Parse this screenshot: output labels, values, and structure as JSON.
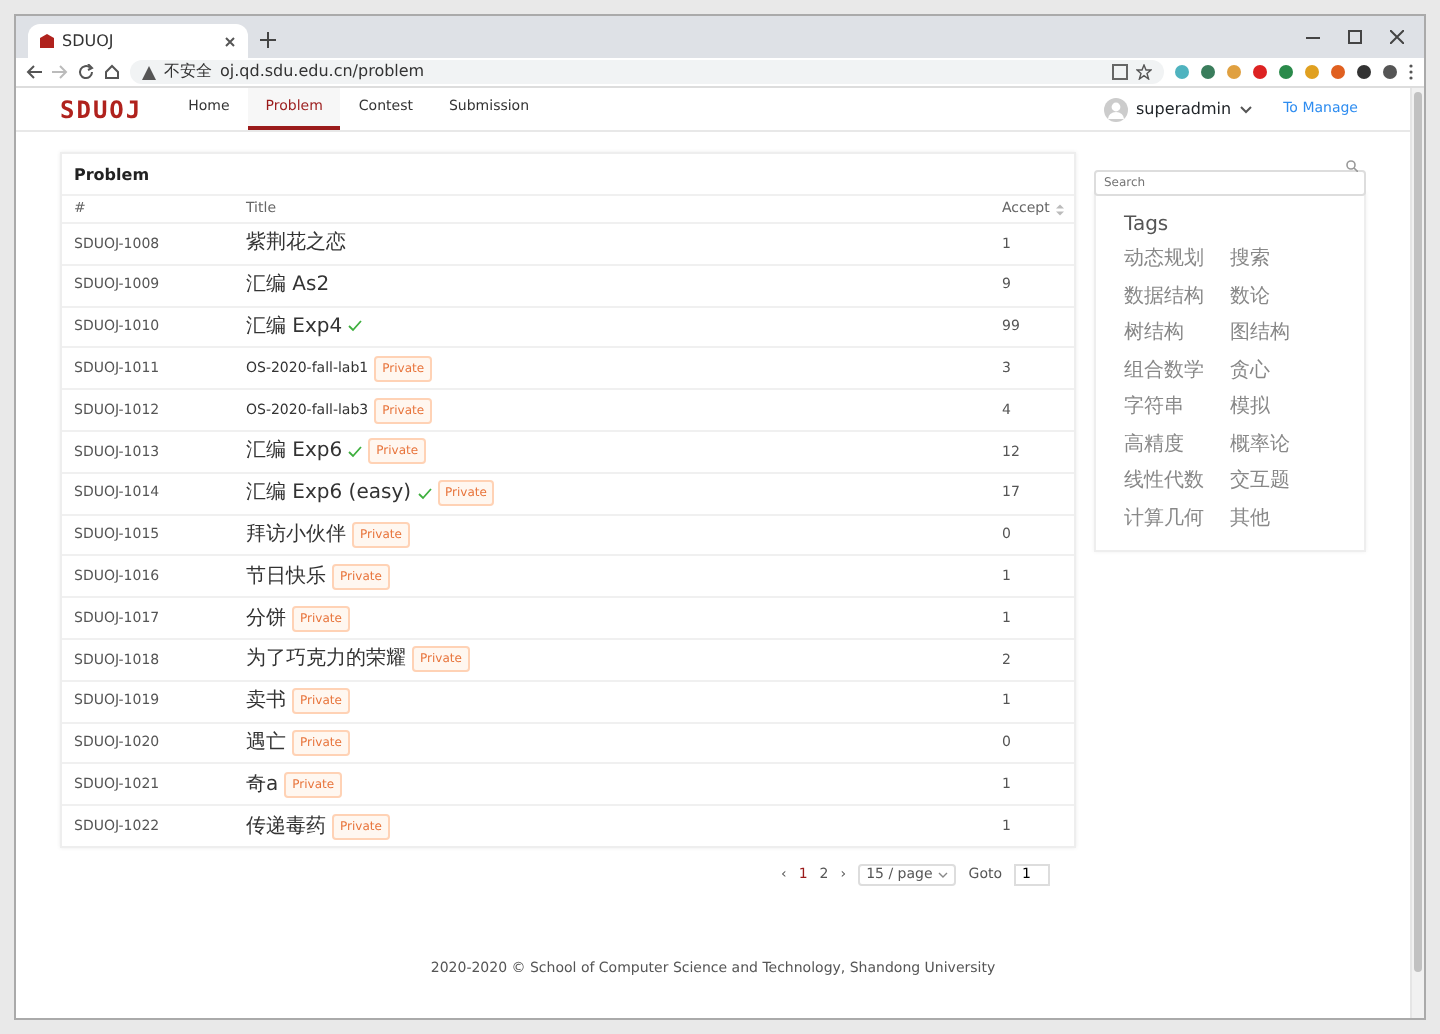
{
  "browser": {
    "tab_title": "SDUOJ",
    "security_label": "不安全",
    "url": "oj.qd.sdu.edu.cn/problem"
  },
  "navbar": {
    "logo": "SDUOJ",
    "items": [
      {
        "label": "Home",
        "selected": false
      },
      {
        "label": "Problem",
        "selected": true
      },
      {
        "label": "Contest",
        "selected": false
      },
      {
        "label": "Submission",
        "selected": false
      }
    ],
    "user": "superadmin",
    "manage_link": "To Manage"
  },
  "problem_card": {
    "title": "Problem",
    "columns": [
      "#",
      "Title",
      "Accept"
    ],
    "rows": [
      {
        "id": "SDUOJ-1008",
        "title": "紫荆花之恋",
        "solved": false,
        "private": false,
        "accept": "1"
      },
      {
        "id": "SDUOJ-1009",
        "title": "汇编 As2",
        "solved": false,
        "private": false,
        "accept": "9"
      },
      {
        "id": "SDUOJ-1010",
        "title": "汇编 Exp4",
        "solved": true,
        "private": false,
        "accept": "99"
      },
      {
        "id": "SDUOJ-1011",
        "title": "OS-2020-fall-lab1",
        "solved": false,
        "private": true,
        "tag": "Private",
        "accept": "3"
      },
      {
        "id": "SDUOJ-1012",
        "title": "OS-2020-fall-lab3",
        "solved": false,
        "private": true,
        "tag": "Private",
        "accept": "4"
      },
      {
        "id": "SDUOJ-1013",
        "title": "汇编 Exp6",
        "solved": true,
        "private": true,
        "tag": "Private",
        "accept": "12"
      },
      {
        "id": "SDUOJ-1014",
        "title": "汇编 Exp6 (easy)",
        "solved": true,
        "private": true,
        "tag": "Private",
        "accept": "17"
      },
      {
        "id": "SDUOJ-1015",
        "title": "拜访小伙伴",
        "solved": false,
        "private": true,
        "tag": "Private",
        "accept": "0"
      },
      {
        "id": "SDUOJ-1016",
        "title": "节日快乐",
        "solved": false,
        "private": true,
        "tag": "Private",
        "accept": "1"
      },
      {
        "id": "SDUOJ-1017",
        "title": "分饼",
        "solved": false,
        "private": true,
        "tag": "Private",
        "accept": "1"
      },
      {
        "id": "SDUOJ-1018",
        "title": "为了巧克力的荣耀",
        "solved": false,
        "private": true,
        "tag": "Private",
        "accept": "2"
      },
      {
        "id": "SDUOJ-1019",
        "title": "卖书",
        "solved": false,
        "private": true,
        "tag": "Private",
        "accept": "1"
      },
      {
        "id": "SDUOJ-1020",
        "title": "遇亡",
        "solved": false,
        "private": true,
        "tag": "Private",
        "accept": "0"
      },
      {
        "id": "SDUOJ-1021",
        "title": "奇a",
        "solved": false,
        "private": true,
        "tag": "Private",
        "accept": "1"
      },
      {
        "id": "SDUOJ-1022",
        "title": "传递毒药",
        "solved": false,
        "private": true,
        "tag": "Private",
        "accept": "1"
      }
    ]
  },
  "pagination": {
    "prev": "‹",
    "pages": [
      {
        "label": "1",
        "selected": true
      },
      {
        "label": "2",
        "selected": false
      }
    ],
    "next": "›",
    "page_size": "15 / page",
    "goto_label": "Goto",
    "goto_value": "1"
  },
  "sidebar": {
    "search_placeholder": "Search",
    "tags_title": "Tags",
    "tags": [
      "动态规划",
      "搜索",
      "数据结构",
      "数论",
      "树结构",
      "图结构",
      "组合数学",
      "贪心",
      "字符串",
      "模拟",
      "高精度",
      "概率论",
      "线性代数",
      "交互题",
      "计算几何",
      "其他"
    ]
  },
  "footer": "2020-2020 © School of Computer Science and Technology, Shandong University"
}
